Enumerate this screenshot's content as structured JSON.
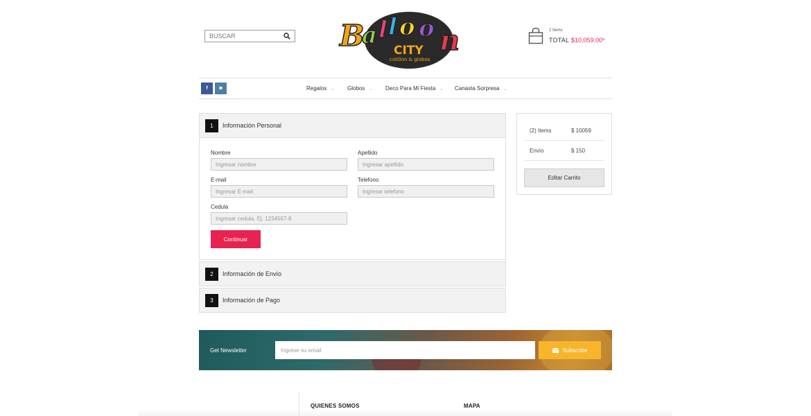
{
  "header": {
    "search": {
      "placeholder": "BUSCAR"
    },
    "logo": {
      "word": "Balloon",
      "city": "CITY",
      "tagline": "cotillon & globos"
    },
    "cart": {
      "count": "2 Items",
      "total_label": "TOTAL",
      "separator": ":",
      "total_value": "$10,059.00",
      "plus": "+"
    }
  },
  "social": {
    "facebook": "f",
    "instagram": "◙"
  },
  "nav": {
    "items": [
      {
        "label": "Regalos"
      },
      {
        "label": "Globos"
      },
      {
        "label": "Deco Para Mi Fiesta"
      },
      {
        "label": "Canasta Sorpresa"
      }
    ],
    "chevron": "⌄"
  },
  "checkout": {
    "steps": [
      {
        "number": "1",
        "title": "Información Personal"
      },
      {
        "number": "2",
        "title": "Información de Envío"
      },
      {
        "number": "3",
        "title": "Información de Pago"
      }
    ],
    "form": {
      "nombre": {
        "label": "Nombre",
        "placeholder": "Ingresar nombre"
      },
      "apellido": {
        "label": "Apellido",
        "placeholder": "Ingresar apellido"
      },
      "email": {
        "label": "E-mail",
        "placeholder": "Ingresar E-mail"
      },
      "telefono": {
        "label": "Telefono",
        "placeholder": "Ingresar telefono"
      },
      "cedula": {
        "label": "Cedula",
        "placeholder": "Ingresar cedula. Ej: 1234567-8"
      },
      "continue_label": "Continuar"
    }
  },
  "summary": {
    "rows": [
      {
        "label": "(2) Items",
        "value": "$ 10059"
      },
      {
        "label": "Envío",
        "value": "$ 150"
      }
    ],
    "edit_label": "Editar Carrito"
  },
  "newsletter": {
    "label": "Get Newsletter",
    "placeholder": "Ingrese su email",
    "button_label": "Subscribe"
  },
  "footer": {
    "col1_title": "QUIENES SOMOS",
    "col2_title": "MAPA"
  },
  "colors": {
    "accent": "#e8234f",
    "subscribe": "#f7b52c",
    "facebook": "#3b5998",
    "instagram": "#517fa4"
  }
}
